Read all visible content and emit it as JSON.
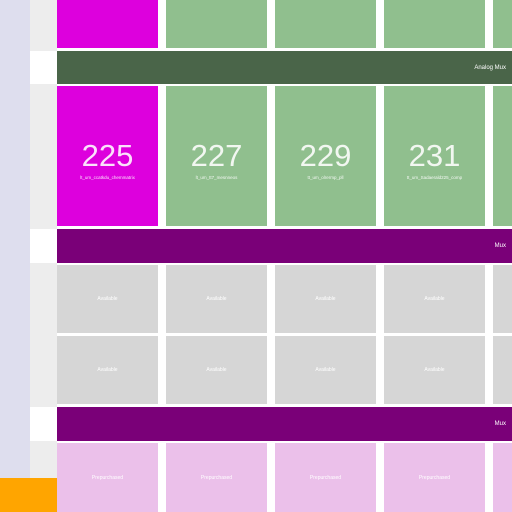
{
  "bars": {
    "analog": "Analog Mux",
    "mux_1": "Mux",
    "mux_2": "Mux"
  },
  "tiles": [
    {
      "number": "225",
      "name": "lt_um_ccatkdu_chemmatrix"
    },
    {
      "number": "227",
      "name": "lt_um_tt7_mesnneos"
    },
    {
      "number": "229",
      "name": "tt_um_olrermp_pll"
    },
    {
      "number": "231",
      "name": "tt_um_Sadaerald225_comp"
    }
  ],
  "grey_label": "Available",
  "pink_label": "Prepurchased",
  "colors": {
    "rail": "#dedeee",
    "analog_bar": "#4a6549",
    "mux_bar": "#7a0078",
    "magenta_tile": "#dd00dd",
    "green_tile": "#90bf8e",
    "available_tile": "#d6d6d6",
    "prepurchased_tile": "#ebc0ea",
    "orange_block": "#ffa500"
  }
}
